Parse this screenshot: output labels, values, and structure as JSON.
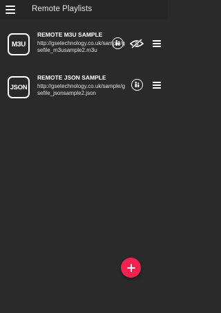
{
  "app_bar": {
    "title": "Remote Playlists",
    "menu_icon": "hamburger-menu-icon"
  },
  "playlists": [
    {
      "badge": "M3U",
      "name": "REMOTE M3U SAMPLE",
      "url": "http://gsetechnology.co.uk/sample/gsefile_m3usample2.m3u",
      "actions": [
        "parental-lock-icon",
        "hidden-eye-icon",
        "more-menu-icon"
      ]
    },
    {
      "badge": "JSON",
      "name": "REMOTE JSON SAMPLE",
      "url": "http://gsetechnology.co.uk/sample/gsefile_jsonsample2.json",
      "actions": [
        "parental-lock-icon",
        "more-menu-icon"
      ]
    }
  ],
  "fab": {
    "icon": "plus-icon",
    "color": "#f0224f"
  },
  "colors": {
    "background": "#2a2a2a",
    "accent": "#f0224f"
  }
}
